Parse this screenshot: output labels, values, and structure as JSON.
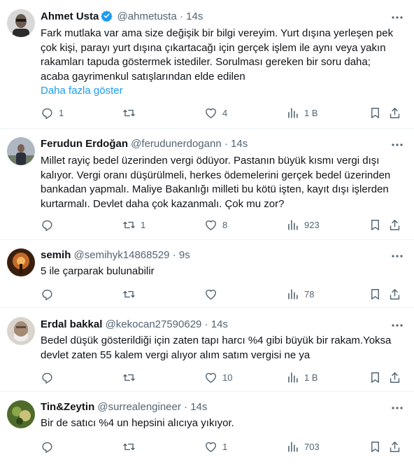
{
  "tweets": [
    {
      "name": "Ahmet Usta",
      "handle": "@ahmetusta",
      "sep": "·",
      "time": "14s",
      "verified": true,
      "lines": [
        "Fark mutlaka var ama size değişik bir bilgi vereyim. Yurt dışına yerleşen pek",
        "çok kişi, parayı yurt dışına çıkartacağı için gerçek işlem ile aynı veya yakın",
        "rakamları tapuda göstermek istediler. Sorulması gereken bir soru daha;",
        "acaba gayrimenkul satışlarından elde edilen"
      ],
      "show_more": "Daha fazla göster",
      "replies": "1",
      "retweets": "",
      "likes": "4",
      "views": "1 B"
    },
    {
      "name": "Ferudun Erdoğan",
      "handle": "@ferudunerdogann",
      "sep": "·",
      "time": "14s",
      "verified": false,
      "lines": [
        "Millet rayiç bedel üzerinden vergi ödüyor. Pastanın büyük kısmı vergi dışı",
        "kalıyor. Vergi oranı düşürülmeli, herkes ödemelerini gerçek bedel üzerinden",
        "bankadan yapmalı. Maliye Bakanlığı milleti bu kötü işten, kayıt dışı işlerden",
        "kurtarmalı. Devlet daha çok kazanmalı. Çok mu zor?"
      ],
      "replies": "",
      "retweets": "1",
      "likes": "8",
      "views": "923"
    },
    {
      "name": "semih",
      "handle": "@semihyk14868529",
      "sep": "·",
      "time": "9s",
      "verified": false,
      "lines": [
        "5 ile çarparak bulunabilir"
      ],
      "replies": "",
      "retweets": "",
      "likes": "",
      "views": "78"
    },
    {
      "name": "Erdal bakkal",
      "handle": "@kekocan27590629",
      "sep": "·",
      "time": "14s",
      "verified": false,
      "lines": [
        "Bedel düşük gösterildiği için zaten tapı harcı %4 gibi büyük bir rakam.Yoksa",
        "devlet zaten 55 kalem vergi alıyor alım satım vergisi ne ya"
      ],
      "replies": "",
      "retweets": "",
      "likes": "10",
      "views": "1 B"
    },
    {
      "name": "Tin&Zeytin",
      "handle": "@surrealengineer",
      "sep": "·",
      "time": "14s",
      "verified": false,
      "lines": [
        "Bir de satıcı %4 un hepsini alıcıya yıkıyor."
      ],
      "replies": "",
      "retweets": "",
      "likes": "1",
      "views": "703"
    }
  ],
  "icons": {
    "verified": "verified-badge-icon",
    "more": "more-icon",
    "reply": "reply-icon",
    "retweet": "retweet-icon",
    "like": "like-icon",
    "views": "views-icon",
    "bookmark": "bookmark-icon",
    "share": "share-icon"
  },
  "colors": {
    "verified": "#1d9bf0",
    "link": "#1d9bf0",
    "secondary": "#536471",
    "text": "#0f1419"
  }
}
